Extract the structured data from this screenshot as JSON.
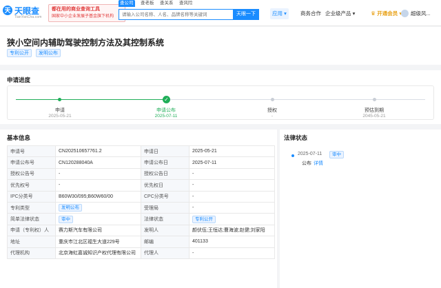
{
  "header": {
    "logo_mark": "天",
    "logo_text": "天眼查",
    "logo_sub": "TianYanCha.com",
    "ad_line1": "都在用的商业查询工具",
    "ad_line2": "国家中小企业发展子基金旗下机构",
    "search_tabs": [
      "查公司",
      "查老板",
      "查关系",
      "查风险"
    ],
    "search_placeholder": "请输入公司名称、人名、品牌名称等关键词",
    "search_button": "天眼一下",
    "nav_app": "应用 ▾",
    "nav_ent": "商务合作",
    "nav_prod": "企业级产品 ▾",
    "nav_vip": "开通会员 ▾",
    "nav_user": "超级风..."
  },
  "patent": {
    "title": "狭小空间内辅助驾驶控制方法及其控制系统",
    "tags": [
      "专利公开",
      "发明公布"
    ]
  },
  "progress": {
    "title": "申请进度",
    "steps": [
      {
        "label": "申请",
        "date": "2025-05-21",
        "status": "done"
      },
      {
        "label": "申请公布",
        "date": "2025-07-11",
        "status": "current"
      },
      {
        "label": "授权",
        "date": "-",
        "status": "pending"
      },
      {
        "label": "预估到期",
        "date": "2045-05-21",
        "status": "pending"
      }
    ]
  },
  "basic": {
    "title": "基本信息",
    "rows": [
      {
        "k1": "申请号",
        "v1": "CN202510657761.2",
        "k2": "申请日",
        "v2": "2025-05-21"
      },
      {
        "k1": "申请公布号",
        "v1": "CN120288040A",
        "k2": "申请公布日",
        "v2": "2025-07-11"
      },
      {
        "k1": "授权公告号",
        "v1": "-",
        "k2": "授权公告日",
        "v2": "-"
      },
      {
        "k1": "优先权号",
        "v1": "-",
        "k2": "优先权日",
        "v2": "-"
      },
      {
        "k1": "IPC分类号",
        "v1": "B60W30/095;B60W60/00",
        "k2": "CPC分类号",
        "v2": "-"
      },
      {
        "k1": "专利类型",
        "v1": "发明公布",
        "k2": "受理局",
        "v2": "-"
      },
      {
        "k1": "简单法律状态",
        "v1": "审中",
        "k2": "法律状态",
        "v2": "专利公开"
      },
      {
        "k1": "申请（专利权）人",
        "v1": "赛力斯汽车有限公司",
        "k2": "发明人",
        "v2": "颜伏伍;王恒达;曹海波;赵健;刘家阳"
      },
      {
        "k1": "地址",
        "v1": "重庆市江北区福生大道229号",
        "k2": "邮编",
        "v2": "401133"
      },
      {
        "k1": "代理机构",
        "v1": "北京海虹嘉诚知识产权代理有限公司",
        "k2": "代理人",
        "v2": "-"
      }
    ]
  },
  "legal": {
    "title": "法律状态",
    "date": "2025-07-11",
    "badge": "审中",
    "desc": "公布",
    "more": "详情"
  },
  "colors": {
    "brand": "#1a8cff",
    "done": "#1fae58",
    "vip": "#e8a21a"
  }
}
